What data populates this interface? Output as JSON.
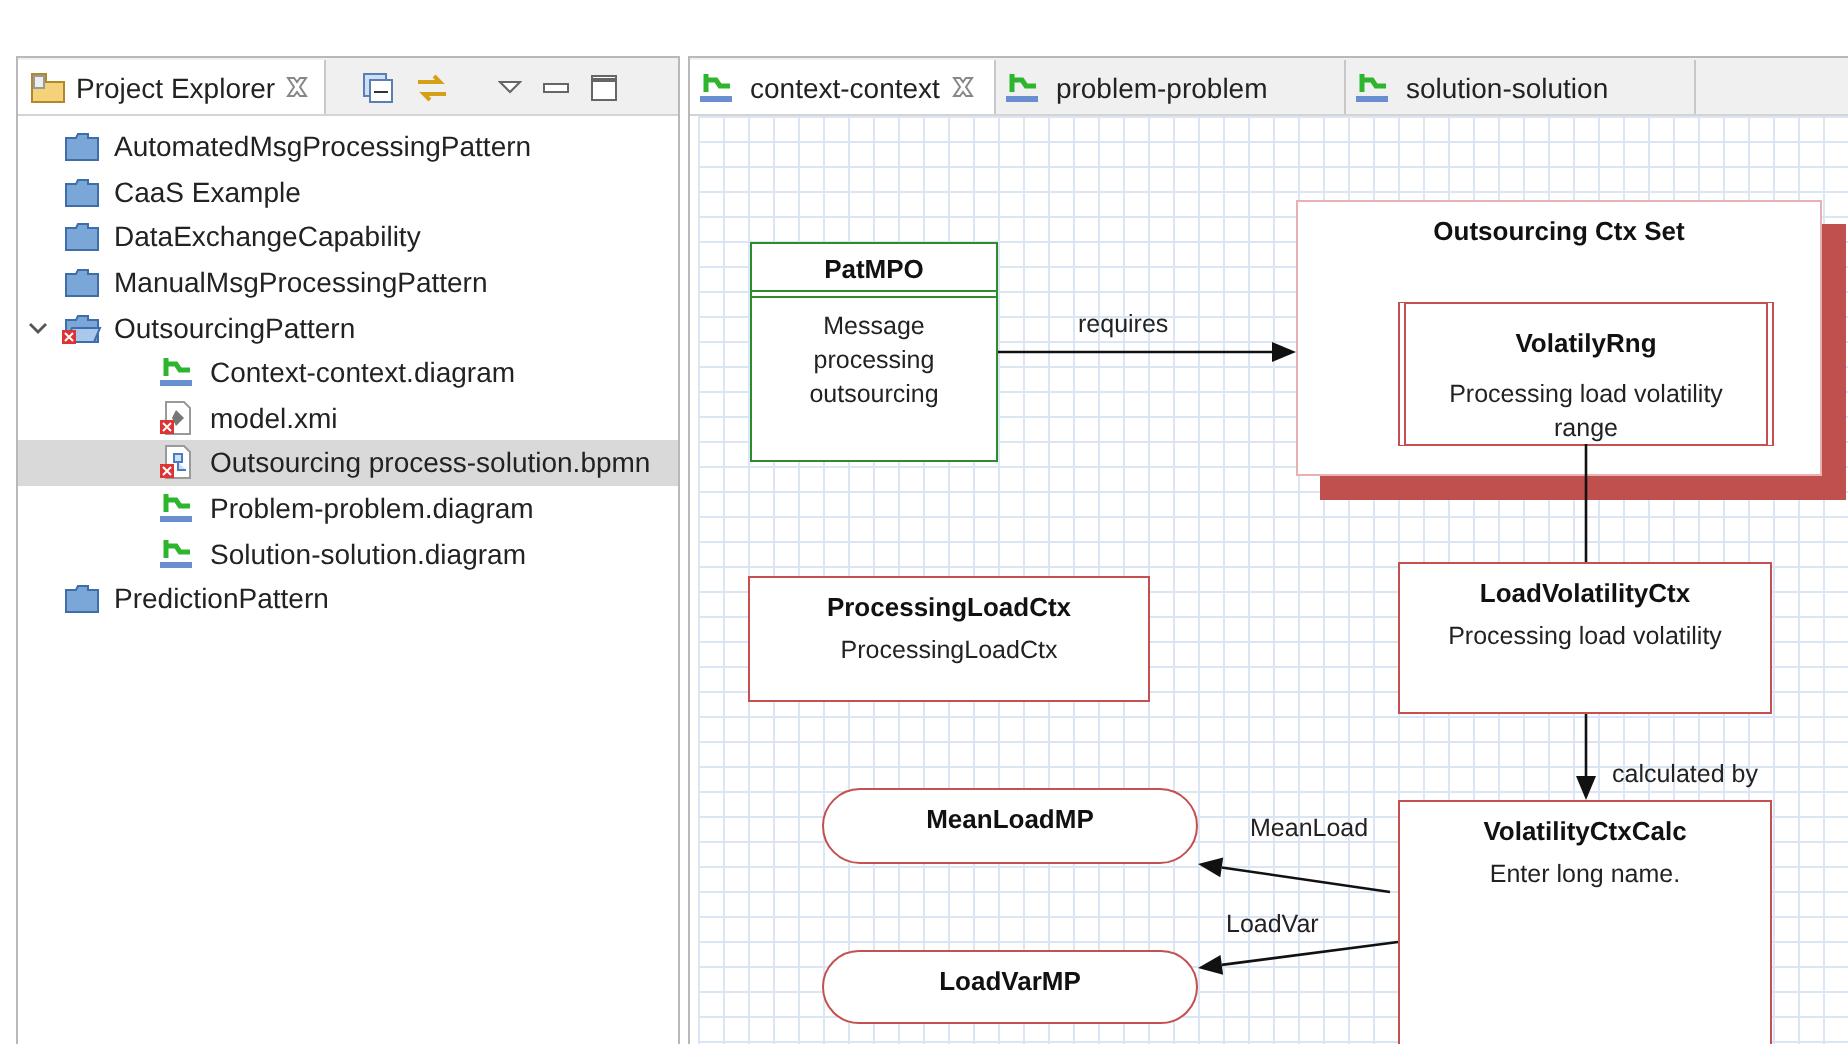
{
  "explorer": {
    "title": "Project Explorer",
    "items": [
      {
        "label": "AutomatedMsgProcessingPattern",
        "kind": "project",
        "selected": false
      },
      {
        "label": "CaaS Example",
        "kind": "project",
        "selected": false
      },
      {
        "label": "DataExchangeCapability",
        "kind": "project",
        "selected": false
      },
      {
        "label": "ManualMsgProcessingPattern",
        "kind": "project",
        "selected": false
      },
      {
        "label": "OutsourcingPattern",
        "kind": "project-error",
        "selected": false,
        "expanded": true,
        "children": [
          {
            "label": "Context-context.diagram",
            "kind": "diagram",
            "selected": false
          },
          {
            "label": "model.xmi",
            "kind": "model-error",
            "selected": false
          },
          {
            "label": "Outsourcing process-solution.bpmn",
            "kind": "bpmn-error",
            "selected": true
          },
          {
            "label": "Problem-problem.diagram",
            "kind": "diagram",
            "selected": false
          },
          {
            "label": "Solution-solution.diagram",
            "kind": "diagram",
            "selected": false
          }
        ]
      },
      {
        "label": "PredictionPattern",
        "kind": "project",
        "selected": false
      }
    ]
  },
  "editor": {
    "tabs": [
      {
        "label": "context-context",
        "selected": true
      },
      {
        "label": "problem-problem",
        "selected": false
      },
      {
        "label": "solution-solution",
        "selected": false
      }
    ],
    "nodes": [
      {
        "kind": "class",
        "title": "PatMPO",
        "text": "Message processing outsourcing"
      },
      {
        "kind": "set",
        "title": "Outsourcing Ctx Set",
        "children": [
          {
            "kind": "range",
            "title": "VolatilyRng",
            "text": "Processing load volatility range"
          }
        ]
      },
      {
        "kind": "context",
        "title": "ProcessingLoadCtx",
        "text": "ProcessingLoadCtx"
      },
      {
        "kind": "context",
        "title": "LoadVolatilityCtx",
        "text": "Processing load volatility"
      },
      {
        "kind": "context",
        "title": "VolatilityCtxCalc",
        "text": "Enter long name."
      },
      {
        "kind": "process",
        "title": "MeanLoadMP"
      },
      {
        "kind": "process",
        "title": "LoadVarMP"
      }
    ],
    "edges": [
      {
        "label": "requires",
        "kind": "arrow"
      },
      {
        "kind": "line"
      },
      {
        "label": "calculated by",
        "kind": "arrow"
      },
      {
        "label": "MeanLoad",
        "kind": "arrow"
      },
      {
        "label": "LoadVar",
        "kind": "arrow"
      }
    ]
  }
}
